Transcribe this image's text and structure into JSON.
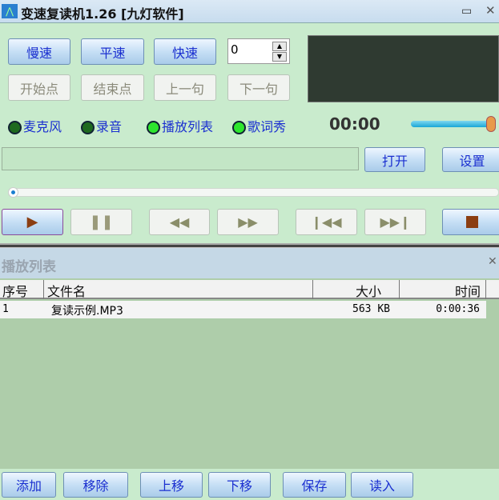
{
  "window": {
    "title": "变速复读机1.26 [九灯软件]",
    "minimize": "▭",
    "close": "✕"
  },
  "speed": {
    "slow": "慢速",
    "normal": "平速",
    "fast": "快速",
    "value": "0"
  },
  "segment": {
    "start": "开始点",
    "end": "结束点",
    "prev": "上一句",
    "next": "下一句"
  },
  "indicators": [
    {
      "label": "麦克风",
      "on": false
    },
    {
      "label": "录音",
      "on": false
    },
    {
      "label": "播放列表",
      "on": true
    },
    {
      "label": "歌词秀",
      "on": true
    }
  ],
  "time": "00:00",
  "volume_percent": 100,
  "seek_percent": 0,
  "file": {
    "path": "",
    "open": "打开",
    "settings": "设置"
  },
  "playlist": {
    "title": "播放列表",
    "close": "✕",
    "columns": [
      "序号",
      "文件名",
      "大小",
      "时间"
    ],
    "rows": [
      {
        "index": "1",
        "name": "复读示例.MP3",
        "size": "563 KB",
        "time": "0:00:36"
      }
    ],
    "buttons": {
      "add": "添加",
      "remove": "移除",
      "up": "上移",
      "down": "下移",
      "save": "保存",
      "load": "读入"
    }
  },
  "colors": {
    "accent": "#1a2fd0",
    "bg": "#c9ebcd",
    "list_bg": "#aecdaa"
  }
}
